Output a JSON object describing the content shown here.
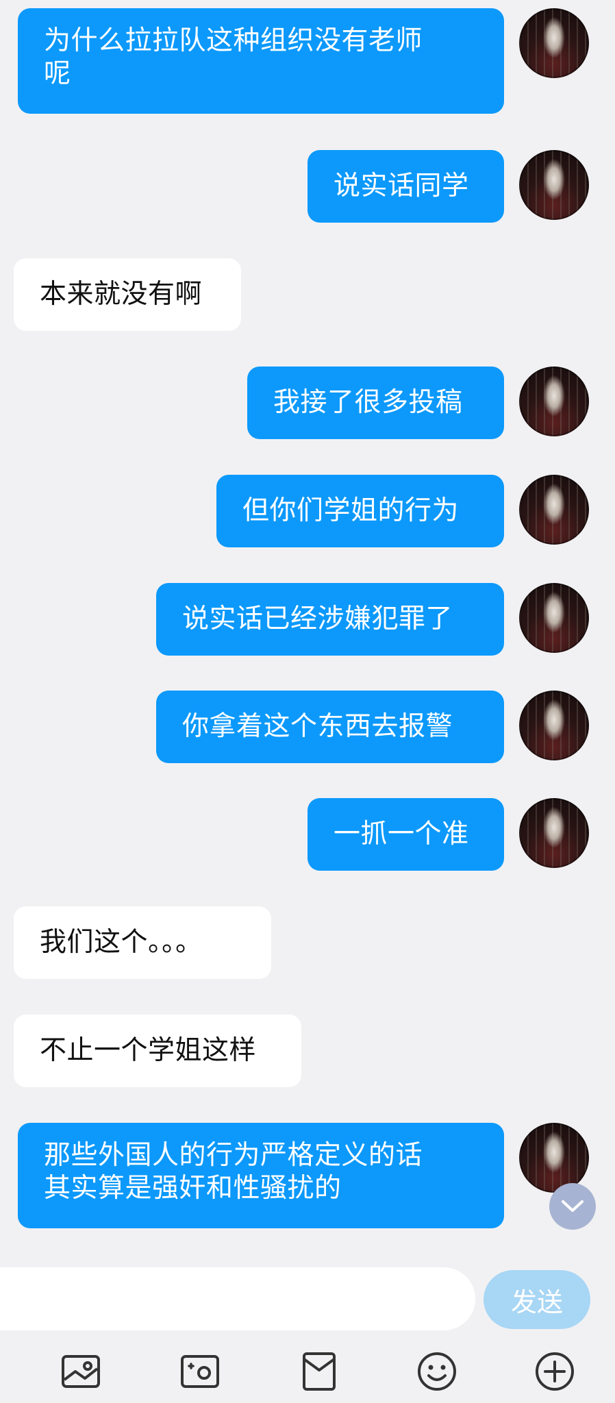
{
  "messages": [
    {
      "side": "out",
      "text": "为什么拉拉队这种组织没有老师\n呢"
    },
    {
      "side": "out",
      "text": "说实话同学"
    },
    {
      "side": "in",
      "text": "本来就没有啊"
    },
    {
      "side": "out",
      "text": "我接了很多投稿"
    },
    {
      "side": "out",
      "text": "但你们学姐的行为"
    },
    {
      "side": "out",
      "text": "说实话已经涉嫌犯罪了"
    },
    {
      "side": "out",
      "text": "你拿着这个东西去报警"
    },
    {
      "side": "out",
      "text": "一抓一个准"
    },
    {
      "side": "in",
      "text": "我们这个。。。"
    },
    {
      "side": "in",
      "text": "不止一个学姐这样"
    },
    {
      "side": "out",
      "text": "那些外国人的行为严格定义的话\n其实算是强奸和性骚扰的"
    }
  ],
  "composer": {
    "input_value": "",
    "send_label": "发送"
  },
  "toolbar": {
    "icons": [
      "image-icon",
      "camera-icon",
      "file-icon",
      "emoji-icon",
      "plus-icon"
    ]
  },
  "colors": {
    "outgoing_bubble": "#0c99fb",
    "incoming_bubble": "#ffffff",
    "background": "#f1f1f3",
    "send_button": "#a8d6f5"
  }
}
